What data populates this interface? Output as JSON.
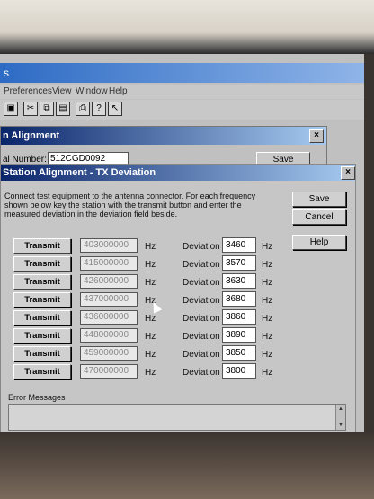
{
  "app": {
    "title_fragment": "s"
  },
  "menubar": [
    "Preferences",
    "View",
    "Window",
    "Help"
  ],
  "toolbar_icons": [
    "save-icon",
    "cut-icon",
    "copy-icon",
    "paste-icon",
    "print-icon",
    "help-icon",
    "context-help-icon"
  ],
  "bg_dialog": {
    "title": "n Alignment",
    "field_label": "al Number:",
    "field_value": "512CGD0092",
    "save_label": "Save"
  },
  "dialog": {
    "title": "Station Alignment - TX Deviation",
    "instructions": "Connect test equipment to the antenna connector. For each frequency shown below key the station with the transmit button and enter the measured deviation in the deviation field beside.",
    "save_label": "Save",
    "cancel_label": "Cancel",
    "help_label": "Help",
    "transmit_label": "Transmit",
    "hz_label": "Hz",
    "deviation_label": "Deviation",
    "rows": [
      {
        "freq": "403000000",
        "deviation": "3460"
      },
      {
        "freq": "415000000",
        "deviation": "3570"
      },
      {
        "freq": "426000000",
        "deviation": "3630"
      },
      {
        "freq": "437000000",
        "deviation": "3680"
      },
      {
        "freq": "436000000",
        "deviation": "3860"
      },
      {
        "freq": "448000000",
        "deviation": "3890"
      },
      {
        "freq": "459000000",
        "deviation": "3850"
      },
      {
        "freq": "470000000",
        "deviation": "3800"
      }
    ],
    "error_label": "Error Messages",
    "error_text": ""
  },
  "close_glyph": "×"
}
